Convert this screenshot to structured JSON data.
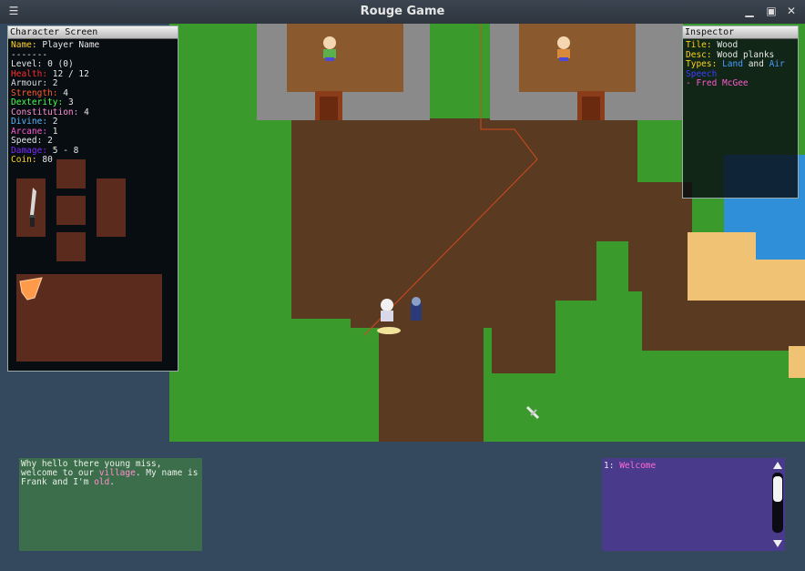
{
  "window": {
    "title": "Rouge Game"
  },
  "character": {
    "title": "Character Screen",
    "name_label": "Name:",
    "name_value": "Player Name",
    "divider": "-------",
    "stats": [
      {
        "label": "Level:",
        "value": "0 (0)",
        "color": "#e8e8e8"
      },
      {
        "label": "Health:",
        "value": "12 / 12",
        "color": "#ff2b2b"
      },
      {
        "label": "Armour:",
        "value": "2",
        "color": "#d8d8d8"
      },
      {
        "label": "Strength:",
        "value": "4",
        "color": "#ff5a2b"
      },
      {
        "label": "Dexterity:",
        "value": "3",
        "color": "#4dff4d"
      },
      {
        "label": "Constitution:",
        "value": "4",
        "color": "#ff8fd0"
      },
      {
        "label": "Divine:",
        "value": "2",
        "color": "#5ab8ff"
      },
      {
        "label": "Arcane:",
        "value": "1",
        "color": "#ff5ad2"
      },
      {
        "label": "Speed:",
        "value": "2",
        "color": "#e8e8e8"
      },
      {
        "label": "Damage:",
        "value": "5 - 8",
        "color": "#7b2bff"
      },
      {
        "label": "Coin:",
        "value": "80",
        "color": "#ffd21a"
      }
    ]
  },
  "inspector": {
    "title": "Inspector",
    "tile_label": "Tile:",
    "tile_value": "Wood",
    "desc_label": "Desc:",
    "desc_value": "Wood planks",
    "types_label": "Types:",
    "type1": "Land",
    "and": "and",
    "type2": "Air",
    "entity_label": "Speech",
    "entity_value": "- Fred McGee"
  },
  "dialog": {
    "part1": "Why hello there young miss, welcome to our ",
    "highlight": "village",
    "part2": ". My name is Frank and I'm ",
    "highlight2": "old",
    "part3": "."
  },
  "log": {
    "index": "1:",
    "entry": "Welcome"
  },
  "colors": {
    "grass": "#3a9a2c",
    "dirt": "#5a3a20",
    "stone": "#8a8a8a",
    "wood": "#8a5a2e",
    "water": "#2f8fd8",
    "sand": "#f0c274"
  }
}
